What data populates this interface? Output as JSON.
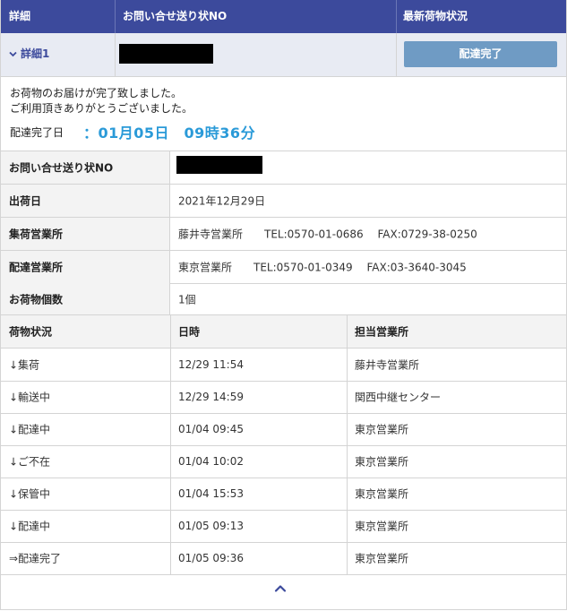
{
  "header": {
    "col_detail": "詳細",
    "col_tracking_no": "お問い合せ送り状NO",
    "col_latest_status": "最新荷物状況"
  },
  "summary": {
    "detail_link": "詳細1",
    "status_button": "配達完了"
  },
  "message": {
    "line1": "お荷物のお届けが完了致しました。",
    "line2": "ご利用頂きありがとうございました。",
    "completed_label": "配達完了日",
    "completed_value": "：01月05日　09時36分"
  },
  "info": {
    "tracking_label": "お問い合せ送り状NO",
    "ship_date_label": "出荷日",
    "ship_date": "2021年12月29日",
    "pickup_office_label": "集荷営業所",
    "pickup_office": "藤井寺営業所　　TEL:0570-01-0686　 FAX:0729-38-0250",
    "delivery_office_label": "配達営業所",
    "delivery_office": "東京営業所　　TEL:0570-01-0349　 FAX:03-3640-3045",
    "pieces_label": "お荷物個数",
    "pieces": "1個"
  },
  "history": {
    "headers": [
      "荷物状況",
      "日時",
      "担当営業所"
    ],
    "rows": [
      [
        "↓集荷",
        "12/29 11:54",
        "藤井寺営業所"
      ],
      [
        "↓輸送中",
        "12/29 14:59",
        "関西中継センター"
      ],
      [
        "↓配達中",
        "01/04 09:45",
        "東京営業所"
      ],
      [
        "↓ご不在",
        "01/04 10:02",
        "東京営業所"
      ],
      [
        "↓保管中",
        "01/04 15:53",
        "東京営業所"
      ],
      [
        "↓配達中",
        "01/05 09:13",
        "東京営業所"
      ],
      [
        "⇒配達完了",
        "01/05 09:36",
        "東京営業所"
      ]
    ]
  },
  "colors": {
    "header_bg": "#3c4a9c",
    "status_button": "#6f9bc4",
    "highlight_text": "#2a9ad8"
  },
  "icons": {
    "toggle": "chevron-down-icon",
    "collapse": "chevron-up-icon"
  }
}
